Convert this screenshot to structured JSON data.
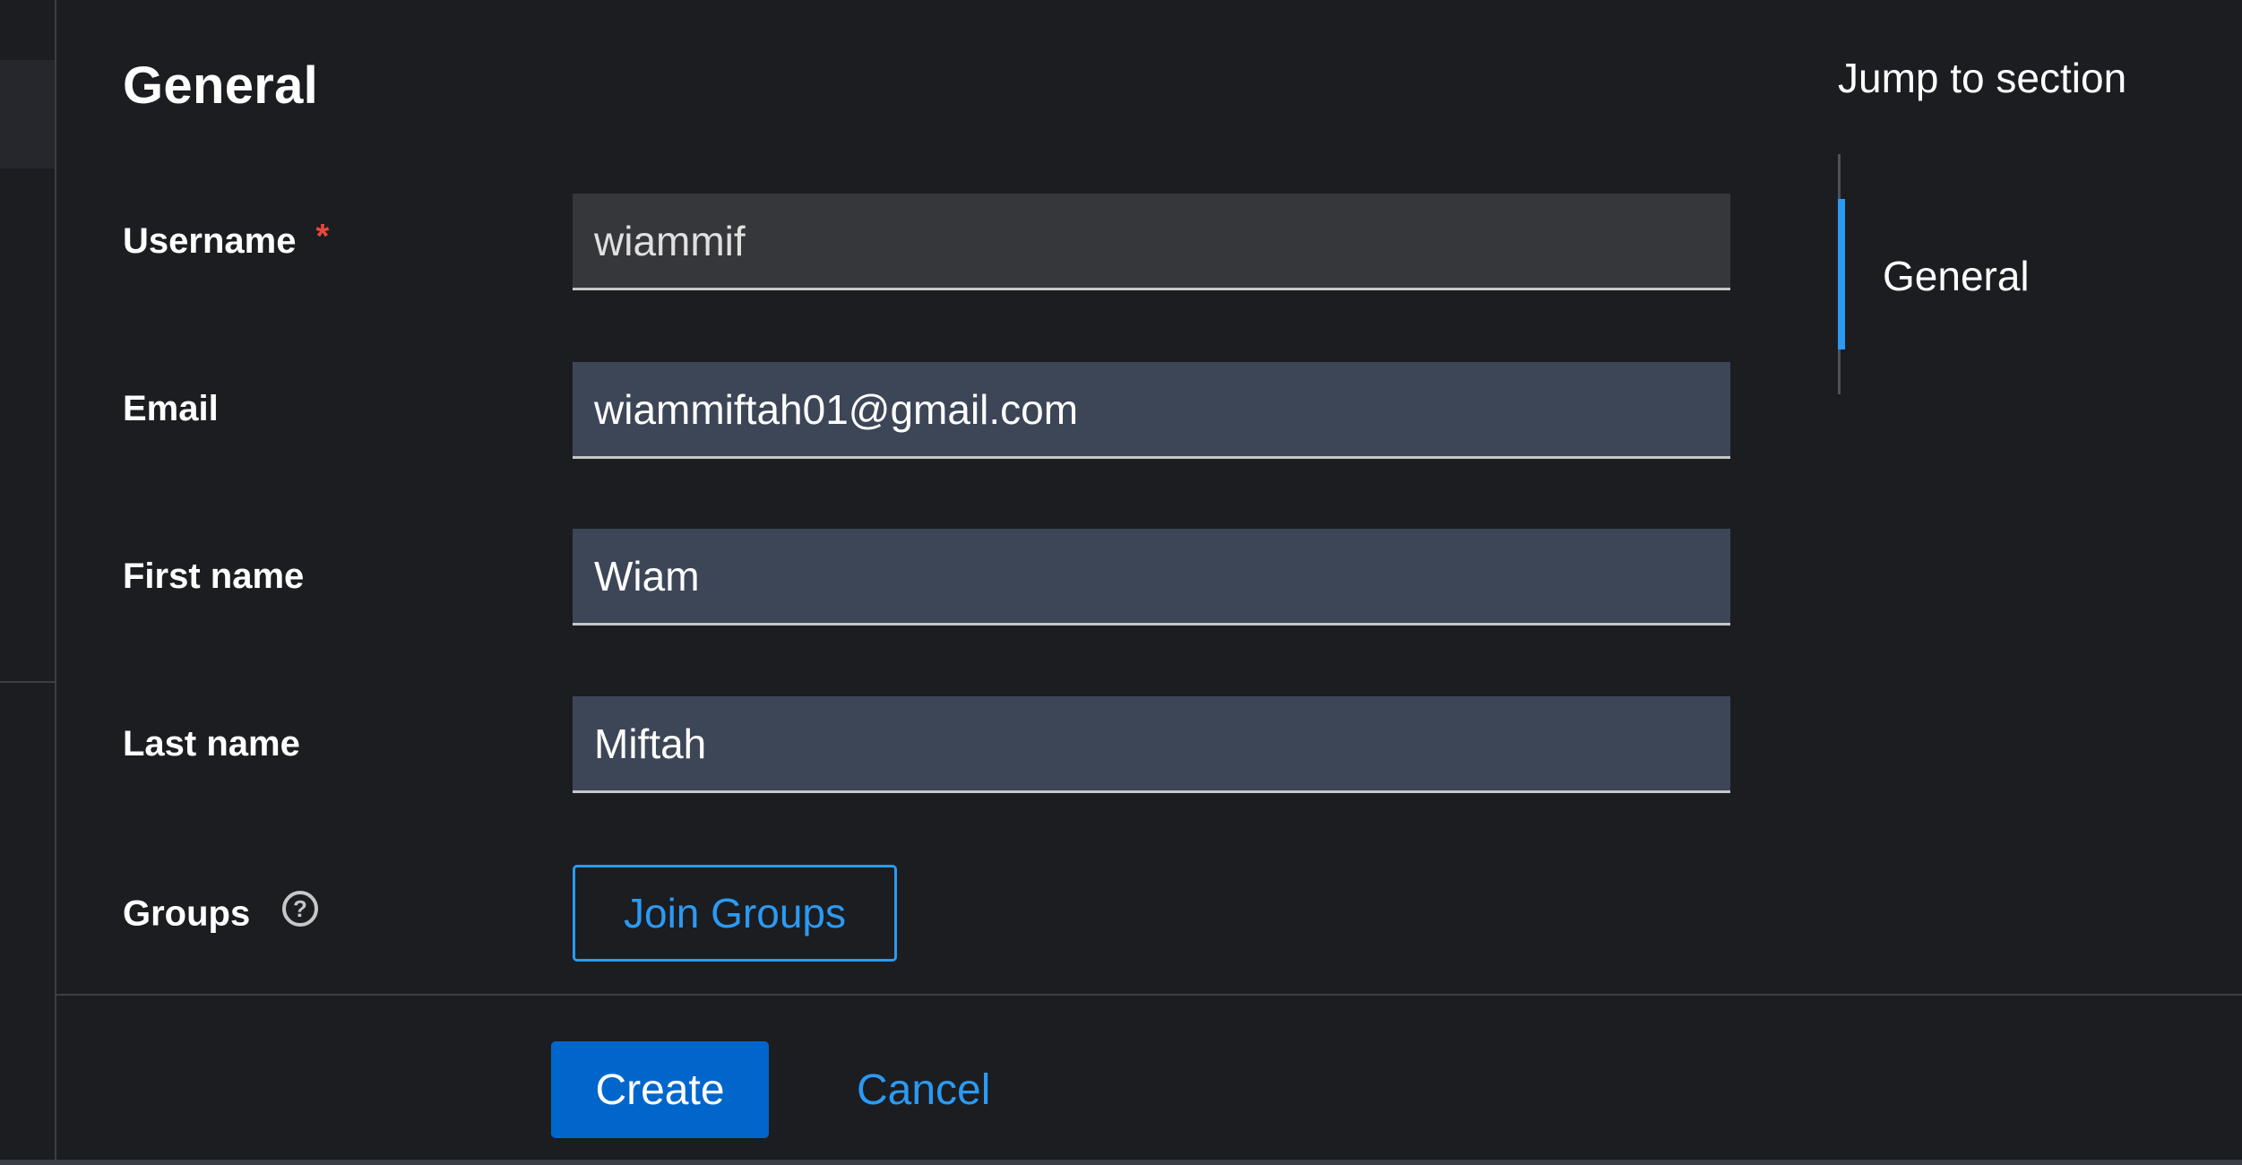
{
  "section_title": "General",
  "form": {
    "username": {
      "label": "Username",
      "required_marker": "*",
      "value": "wiammif"
    },
    "email": {
      "label": "Email",
      "value": "wiammiftah01@gmail.com"
    },
    "first_name": {
      "label": "First name",
      "value": "Wiam"
    },
    "last_name": {
      "label": "Last name",
      "value": "Miftah"
    },
    "groups": {
      "label": "Groups",
      "help_icon": "question-circle-icon",
      "button_label": "Join Groups"
    }
  },
  "footer": {
    "create_label": "Create",
    "cancel_label": "Cancel"
  },
  "jump_to_section": {
    "title": "Jump to section",
    "items": [
      {
        "label": "General",
        "active": true
      }
    ]
  },
  "colors": {
    "background": "#1b1d21",
    "primary": "#0066cc",
    "link": "#2b9af3",
    "required": "#e8483f",
    "input_readonly_bg": "#36373b",
    "input_bg": "#3d4657"
  }
}
